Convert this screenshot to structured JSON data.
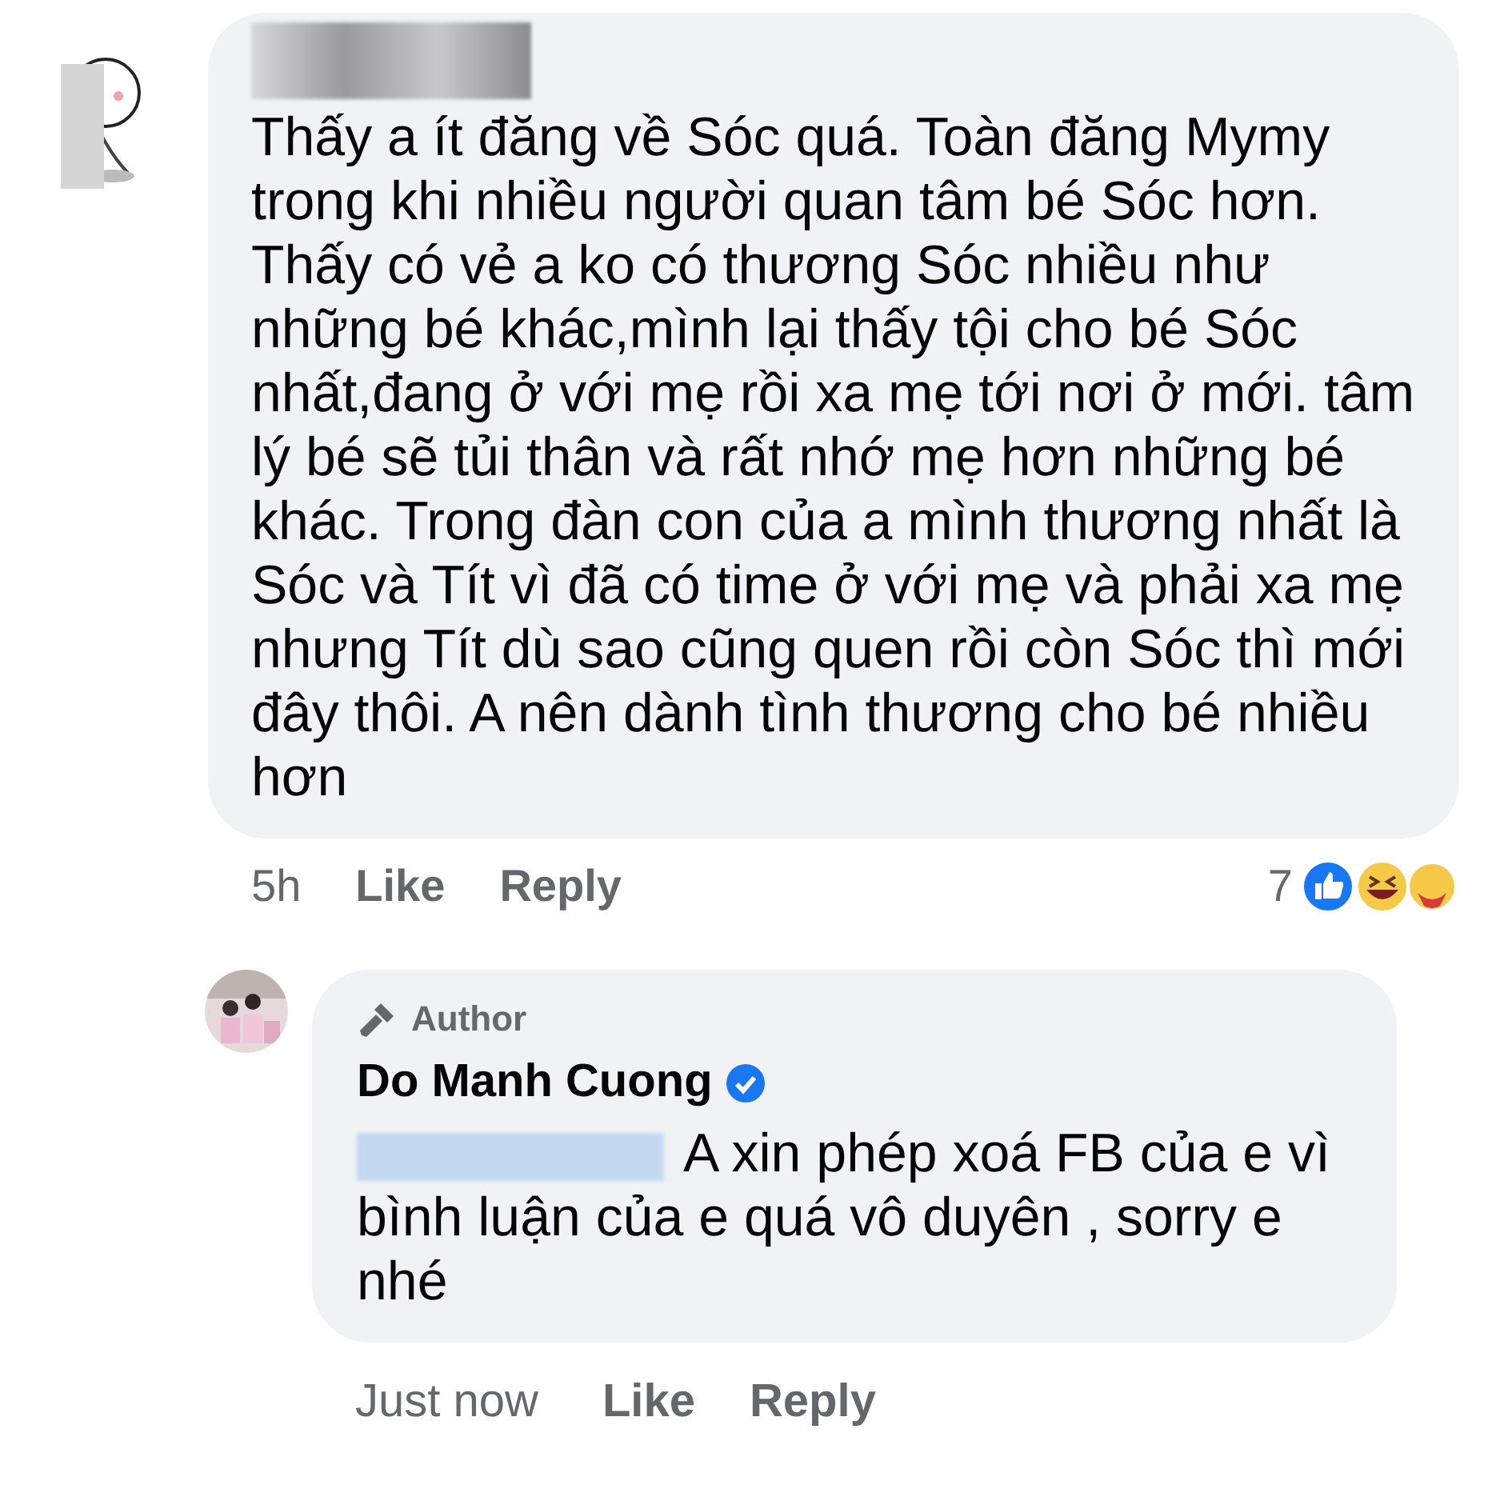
{
  "comment": {
    "name_redacted": true,
    "text": "Thấy a ít đăng về Sóc quá. Toàn đăng Mymy trong khi nhiều người quan tâm bé Sóc hơn. Thấy có vẻ a ko có thương Sóc nhiều như những bé khác,mình lại thấy tội cho bé Sóc nhất,đang ở với mẹ rồi xa mẹ tới nơi ở mới. tâm lý bé sẽ tủi thân và rất nhớ mẹ hơn những bé khác. Trong đàn con của a mình thương nhất là Sóc và Tít vì đã có time ở với mẹ và phải xa mẹ nhưng Tít dù sao cũng quen rồi còn Sóc thì mới đây thôi. A nên dành tình thương cho bé nhiều hơn",
    "time": "5h",
    "actions": [
      "Like",
      "Reply"
    ],
    "reaction_count": "7"
  },
  "reply": {
    "badge": "Author",
    "name": "Do Manh Cuong",
    "verified": true,
    "mention_redacted": true,
    "text": "A xin phép xoá FB của e vì bình luận của e quá vô duyên , sorry e nhé",
    "time": "Just now",
    "actions": [
      "Like",
      "Reply"
    ]
  }
}
